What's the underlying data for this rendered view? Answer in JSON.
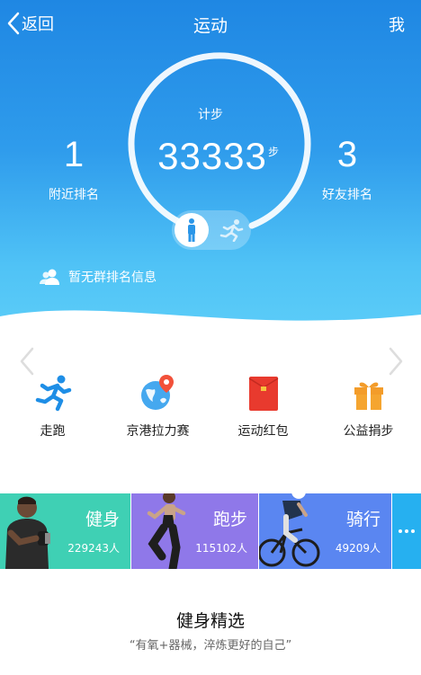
{
  "header": {
    "back_label": "返回",
    "title": "运动",
    "me_label": "我"
  },
  "steps": {
    "label": "计步",
    "count": "33333",
    "unit": "步"
  },
  "ranks": {
    "nearby_value": "1",
    "nearby_label": "附近排名",
    "friends_value": "3",
    "friends_label": "好友排名"
  },
  "group_info": "暂无群排名信息",
  "shortcuts": [
    {
      "label": "走跑",
      "icon": "running-man-icon"
    },
    {
      "label": "京港拉力赛",
      "icon": "globe-pin-icon"
    },
    {
      "label": "运动红包",
      "icon": "red-envelope-icon"
    },
    {
      "label": "公益捐步",
      "icon": "gift-box-icon"
    }
  ],
  "cards": [
    {
      "title": "健身",
      "count": "229243人",
      "color": "#3fd0b4"
    },
    {
      "title": "跑步",
      "count": "115102人",
      "color": "#8f78e9"
    },
    {
      "title": "骑行",
      "count": "49209人",
      "color": "#5a86f1"
    }
  ],
  "section": {
    "title": "健身精选",
    "subtitle": "“有氧+器械，淬炼更好的自己”"
  },
  "colors": {
    "hero_top": "#1f87e3",
    "hero_bottom": "#5ccdf8",
    "accent_blue": "#2592e6"
  }
}
